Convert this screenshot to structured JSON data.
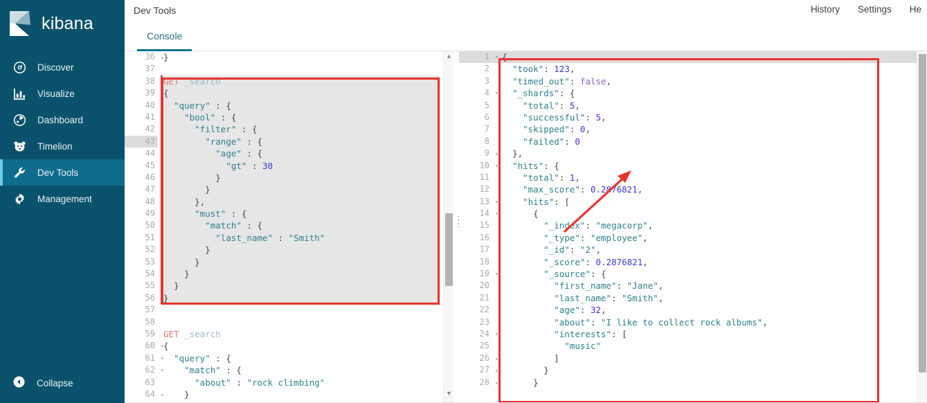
{
  "brand": {
    "name": "kibana",
    "logo_icon": "kibana-logo-icon"
  },
  "sidebar": {
    "items": [
      {
        "label": "Discover",
        "icon": "compass-icon",
        "active": false
      },
      {
        "label": "Visualize",
        "icon": "bar-chart-icon",
        "active": false
      },
      {
        "label": "Dashboard",
        "icon": "dashboard-icon",
        "active": false
      },
      {
        "label": "Timelion",
        "icon": "bear-face-icon",
        "active": false
      },
      {
        "label": "Dev Tools",
        "icon": "wrench-icon",
        "active": true
      },
      {
        "label": "Management",
        "icon": "gear-icon",
        "active": false
      }
    ],
    "collapse": {
      "label": "Collapse",
      "icon": "chevron-left-circle-icon"
    }
  },
  "header": {
    "title": "Dev Tools",
    "links": [
      "History",
      "Settings",
      "He"
    ]
  },
  "tabs": [
    {
      "label": "Console",
      "active": true
    }
  ],
  "colors": {
    "sidebar_bg": "#0a526b",
    "sidebar_active_bg": "#0e6c8c",
    "accent": "#0e7490",
    "annotation_red": "#e8322f",
    "run_green": "#4caf50",
    "method": "#e2786c",
    "string": "#2e7f8e",
    "number": "#3a3ad0",
    "boolean": "#8a63d2"
  },
  "editor": {
    "name": "request-editor",
    "run_button_icon": "play-triangle-icon",
    "wrench_button_icon": "wrench-icon",
    "first_line_number": 36,
    "active_line": 43,
    "selected_request_lines": [
      38,
      56
    ],
    "lines": [
      {
        "n": 36,
        "fold": "up",
        "text": "}"
      },
      {
        "n": 37,
        "fold": "",
        "text": ""
      },
      {
        "n": 38,
        "fold": "",
        "text": "GET _search",
        "method": "GET",
        "url": "_search"
      },
      {
        "n": 39,
        "fold": "down",
        "text": "{"
      },
      {
        "n": 40,
        "fold": "down",
        "text": "  \"query\" : {"
      },
      {
        "n": 41,
        "fold": "down",
        "text": "    \"bool\" : {"
      },
      {
        "n": 42,
        "fold": "down",
        "text": "      \"filter\" : {"
      },
      {
        "n": 43,
        "fold": "down",
        "text": "        \"range\" : {"
      },
      {
        "n": 44,
        "fold": "down",
        "text": "          \"age\" : {"
      },
      {
        "n": 45,
        "fold": "",
        "text": "            \"gt\" : 30"
      },
      {
        "n": 46,
        "fold": "up",
        "text": "          }"
      },
      {
        "n": 47,
        "fold": "up",
        "text": "        }"
      },
      {
        "n": 48,
        "fold": "up",
        "text": "      },"
      },
      {
        "n": 49,
        "fold": "down",
        "text": "      \"must\" : {"
      },
      {
        "n": 50,
        "fold": "down",
        "text": "        \"match\" : {"
      },
      {
        "n": 51,
        "fold": "",
        "text": "          \"last_name\" : \"Smith\""
      },
      {
        "n": 52,
        "fold": "up",
        "text": "        }"
      },
      {
        "n": 53,
        "fold": "up",
        "text": "      }"
      },
      {
        "n": 54,
        "fold": "up",
        "text": "    }"
      },
      {
        "n": 55,
        "fold": "up",
        "text": "  }"
      },
      {
        "n": 56,
        "fold": "up",
        "text": "}"
      },
      {
        "n": 57,
        "fold": "",
        "text": ""
      },
      {
        "n": 58,
        "fold": "",
        "text": ""
      },
      {
        "n": 59,
        "fold": "",
        "text": "GET _search",
        "method": "GET",
        "url": "_search"
      },
      {
        "n": 60,
        "fold": "down",
        "text": "{"
      },
      {
        "n": 61,
        "fold": "down",
        "text": "  \"query\" : {"
      },
      {
        "n": 62,
        "fold": "down",
        "text": "    \"match\" : {"
      },
      {
        "n": 63,
        "fold": "",
        "text": "      \"about\" : \"rock climbing\""
      },
      {
        "n": 64,
        "fold": "up",
        "text": "    }"
      }
    ],
    "scrollbar": {
      "up_arrow": "▲",
      "down_arrow": "▼"
    }
  },
  "response": {
    "name": "response-viewer",
    "active_line": 1,
    "lines": [
      {
        "n": 1,
        "fold": "down",
        "text": "{"
      },
      {
        "n": 2,
        "fold": "",
        "text": "  \"took\": 123,"
      },
      {
        "n": 3,
        "fold": "",
        "text": "  \"timed_out\": false,"
      },
      {
        "n": 4,
        "fold": "down",
        "text": "  \"_shards\": {"
      },
      {
        "n": 5,
        "fold": "",
        "text": "    \"total\": 5,"
      },
      {
        "n": 6,
        "fold": "",
        "text": "    \"successful\": 5,"
      },
      {
        "n": 7,
        "fold": "",
        "text": "    \"skipped\": 0,"
      },
      {
        "n": 8,
        "fold": "",
        "text": "    \"failed\": 0"
      },
      {
        "n": 9,
        "fold": "up",
        "text": "  },"
      },
      {
        "n": 10,
        "fold": "down",
        "text": "  \"hits\": {"
      },
      {
        "n": 11,
        "fold": "",
        "text": "    \"total\": 1,"
      },
      {
        "n": 12,
        "fold": "",
        "text": "    \"max_score\": 0.2876821,"
      },
      {
        "n": 13,
        "fold": "down",
        "text": "    \"hits\": ["
      },
      {
        "n": 14,
        "fold": "down",
        "text": "      {"
      },
      {
        "n": 15,
        "fold": "",
        "text": "        \"_index\": \"megacorp\","
      },
      {
        "n": 16,
        "fold": "",
        "text": "        \"_type\": \"employee\","
      },
      {
        "n": 17,
        "fold": "",
        "text": "        \"_id\": \"2\","
      },
      {
        "n": 18,
        "fold": "",
        "text": "        \"_score\": 0.2876821,"
      },
      {
        "n": 19,
        "fold": "down",
        "text": "        \"_source\": {"
      },
      {
        "n": 20,
        "fold": "",
        "text": "          \"first_name\": \"Jane\","
      },
      {
        "n": 21,
        "fold": "",
        "text": "          \"last_name\": \"Smith\","
      },
      {
        "n": 22,
        "fold": "",
        "text": "          \"age\": 32,"
      },
      {
        "n": 23,
        "fold": "",
        "text": "          \"about\": \"I like to collect rock albums\","
      },
      {
        "n": 24,
        "fold": "down",
        "text": "          \"interests\": ["
      },
      {
        "n": 25,
        "fold": "",
        "text": "            \"music\""
      },
      {
        "n": 26,
        "fold": "up",
        "text": "          ]"
      },
      {
        "n": 27,
        "fold": "up",
        "text": "        }"
      },
      {
        "n": 28,
        "fold": "up",
        "text": "      }"
      }
    ]
  },
  "annotations": {
    "request_box": "highlight-box-request",
    "response_box": "highlight-box-response",
    "arrow": "pointer-arrow"
  }
}
